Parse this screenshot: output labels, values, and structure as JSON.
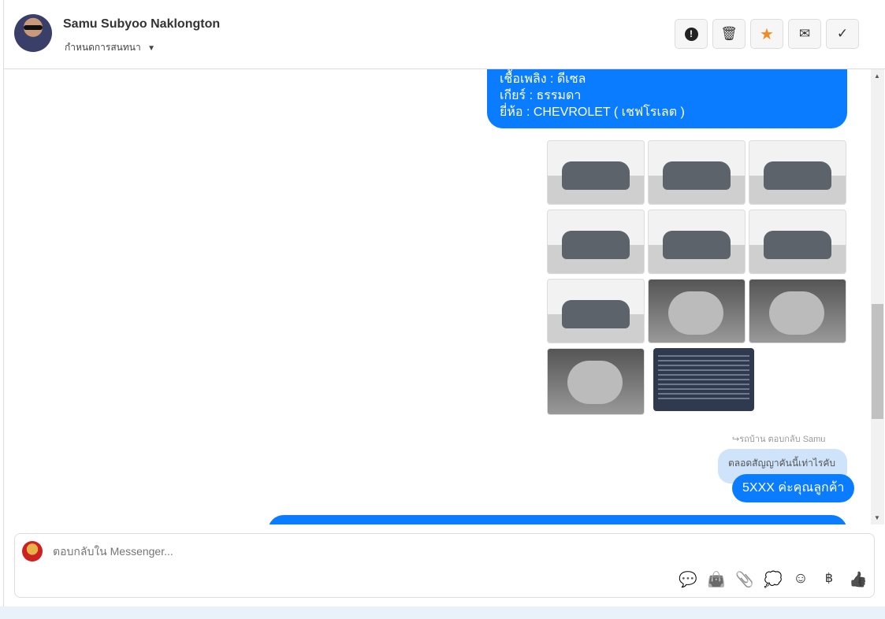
{
  "header": {
    "name": "Samu Subyoo Naklongton",
    "subtitle": "กำหนดการสนทนา",
    "subtitle_caret": "▼",
    "buttons": [
      {
        "name": "report-button",
        "icon": "!"
      },
      {
        "name": "delete-button",
        "icon": "🗑"
      },
      {
        "name": "star-button",
        "icon": "★"
      },
      {
        "name": "mail-button",
        "icon": "✉"
      },
      {
        "name": "done-button",
        "icon": "✓"
      }
    ]
  },
  "messages": {
    "car_info": [
      "เชื้อเพลิง : ดีเซล",
      "เกียร์ : ธรรมดา",
      "ยี่ห้อ : CHEVROLET ( เชฟโรเลต )"
    ],
    "reply_note": "↪รถบ้าน ตอบกลับ Samu",
    "quoted": "ตลอดสัญญาคันนี้เท่าไรคับ",
    "reply": "5XXX ค่ะคุณลูกค้า"
  },
  "composer": {
    "placeholder": "ตอบกลับใน Messenger...",
    "tools": [
      "💬",
      "👜",
      "📎",
      "💭",
      "☺",
      "฿",
      "👍"
    ]
  },
  "colors": {
    "accent": "#0a7cff",
    "star": "#f08a24"
  }
}
